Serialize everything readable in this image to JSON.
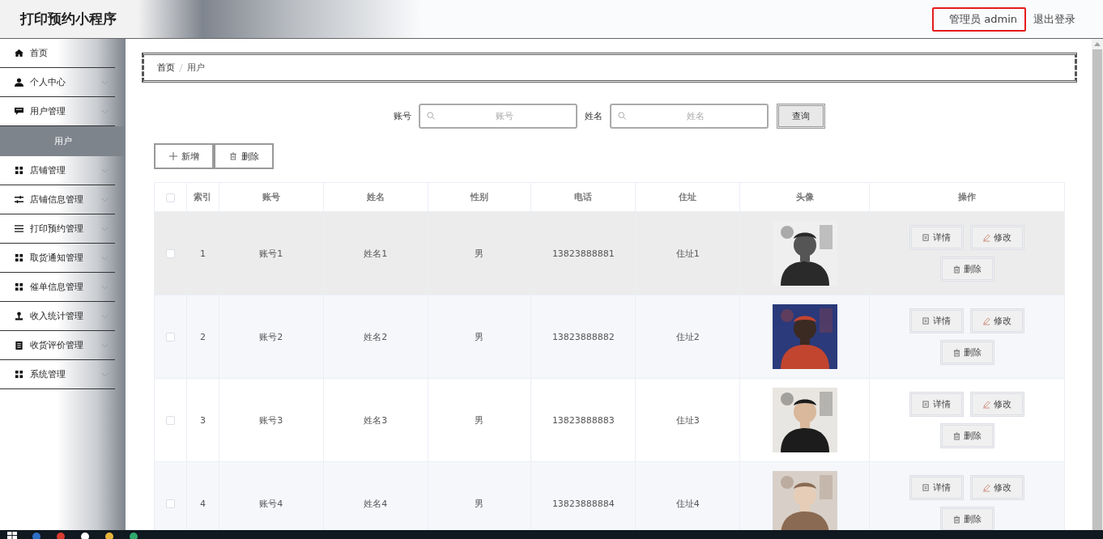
{
  "header": {
    "title": "打印预约小程序",
    "user": "管理员 admin",
    "logout": "退出登录"
  },
  "sidebar": {
    "items": [
      {
        "label": "首页",
        "expandable": false
      },
      {
        "label": "个人中心",
        "expandable": true
      },
      {
        "label": "用户管理",
        "expandable": true,
        "children": [
          {
            "label": "用户",
            "selected": true
          }
        ]
      },
      {
        "label": "店铺管理",
        "expandable": true
      },
      {
        "label": "店铺信息管理",
        "expandable": true
      },
      {
        "label": "打印预约管理",
        "expandable": true
      },
      {
        "label": "取货通知管理",
        "expandable": true
      },
      {
        "label": "催单信息管理",
        "expandable": true
      },
      {
        "label": "收入统计管理",
        "expandable": true
      },
      {
        "label": "收货评价管理",
        "expandable": true
      },
      {
        "label": "系统管理",
        "expandable": true
      }
    ]
  },
  "breadcrumb": [
    "首页",
    "用户"
  ],
  "search": {
    "fields": [
      {
        "label": "账号",
        "placeholder": "账号"
      },
      {
        "label": "姓名",
        "placeholder": "姓名"
      }
    ],
    "button": "查询"
  },
  "actions": [
    "新增",
    "删除"
  ],
  "table": {
    "header_checked": false,
    "columns": [
      "索引",
      "账号",
      "姓名",
      "性别",
      "电话",
      "住址",
      "头像",
      "操作"
    ],
    "rows": [
      {
        "checked": false,
        "highlighted": true,
        "cells": [
          "1",
          "账号1",
          "姓名1",
          "男",
          "13823888881",
          "住址1"
        ],
        "avatar": {
          "kind": "picture"
        },
        "buttons": [
          "详情",
          "修改",
          "删除"
        ]
      },
      {
        "checked": false,
        "highlighted": false,
        "cells": [
          "2",
          "账号2",
          "姓名2",
          "男",
          "13823888882",
          "住址2"
        ],
        "avatar": {
          "kind": "picture"
        },
        "buttons": [
          "详情",
          "修改",
          "删除"
        ]
      },
      {
        "checked": false,
        "highlighted": false,
        "cells": [
          "3",
          "账号3",
          "姓名3",
          "男",
          "13823888883",
          "住址3"
        ],
        "avatar": {
          "kind": "picture"
        },
        "buttons": [
          "详情",
          "修改",
          "删除"
        ]
      },
      {
        "checked": false,
        "highlighted": false,
        "cells": [
          "4",
          "账号4",
          "姓名4",
          "男",
          "13823888884",
          "住址4"
        ],
        "avatar": {
          "kind": "picture"
        },
        "buttons": [
          "详情",
          "修改",
          "删除"
        ]
      }
    ]
  }
}
